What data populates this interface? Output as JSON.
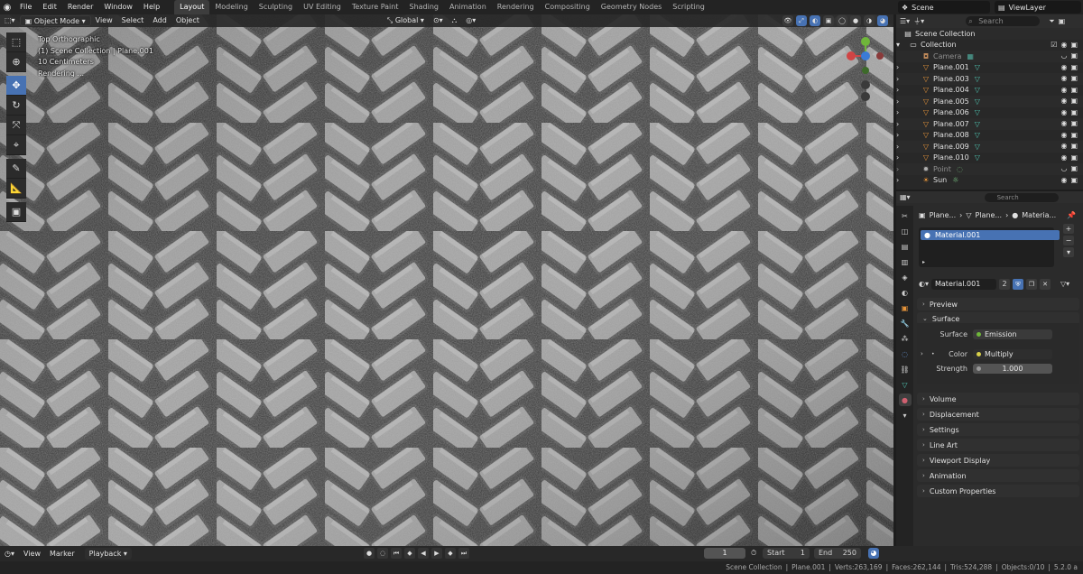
{
  "topbar": {
    "menus": [
      "File",
      "Edit",
      "Render",
      "Window",
      "Help"
    ],
    "workspaces": [
      "Layout",
      "Modeling",
      "Sculpting",
      "UV Editing",
      "Texture Paint",
      "Shading",
      "Animation",
      "Rendering",
      "Compositing",
      "Geometry Nodes",
      "Scripting"
    ],
    "active_workspace": "Layout",
    "scene": "Scene",
    "view_layer": "ViewLayer"
  },
  "viewport": {
    "mode": "Object Mode",
    "menus": [
      "View",
      "Select",
      "Add",
      "Object"
    ],
    "orientation": "Global",
    "overlay_lines": [
      "Top Orthographic",
      "(1) Scene Collection | Plane.001",
      "10 Centimeters",
      "Rendering ..."
    ]
  },
  "outliner": {
    "search_placeholder": "Search",
    "root": "Scene Collection",
    "collection": "Collection",
    "items": [
      {
        "name": "Camera",
        "type": "camera",
        "dim": true
      },
      {
        "name": "Plane.001",
        "type": "mesh",
        "dim": false
      },
      {
        "name": "Plane.003",
        "type": "mesh",
        "dim": false
      },
      {
        "name": "Plane.004",
        "type": "mesh",
        "dim": false
      },
      {
        "name": "Plane.005",
        "type": "mesh",
        "dim": false
      },
      {
        "name": "Plane.006",
        "type": "mesh",
        "dim": false
      },
      {
        "name": "Plane.007",
        "type": "mesh",
        "dim": false
      },
      {
        "name": "Plane.008",
        "type": "mesh",
        "dim": false
      },
      {
        "name": "Plane.009",
        "type": "mesh",
        "dim": false
      },
      {
        "name": "Plane.010",
        "type": "mesh",
        "dim": false
      },
      {
        "name": "Point",
        "type": "light",
        "dim": true
      },
      {
        "name": "Sun",
        "type": "light",
        "dim": false
      }
    ]
  },
  "properties": {
    "search_placeholder": "Search",
    "breadcrumb": [
      "Plane...",
      "Plane...",
      "Materia..."
    ],
    "slot_item": "Material.001",
    "material_name": "Material.001",
    "users": "2",
    "panels": {
      "preview": "Preview",
      "surface": "Surface",
      "volume": "Volume",
      "displacement": "Displacement",
      "settings": "Settings",
      "line_art": "Line Art",
      "viewport_display": "Viewport Display",
      "animation": "Animation",
      "custom_properties": "Custom Properties"
    },
    "surface_label": "Surface",
    "surface_value": "Emission",
    "color_label": "Color",
    "color_value": "Multiply",
    "strength_label": "Strength",
    "strength_value": "1.000"
  },
  "timeline": {
    "menus": [
      "View",
      "Marker",
      "Playback"
    ],
    "current_frame": "1",
    "start_label": "Start",
    "start_value": "1",
    "end_label": "End",
    "end_value": "250"
  },
  "statusbar": {
    "collection": "Scene Collection",
    "object": "Plane.001",
    "verts": "Verts:263,169",
    "faces": "Faces:262,144",
    "tris": "Tris:524,288",
    "objects": "Objects:0/10",
    "version": "5.2.0 a"
  },
  "colors": {
    "accent": "#4772b3",
    "mesh_icon": "#4fc3b0",
    "object_icon": "#e8953a"
  }
}
